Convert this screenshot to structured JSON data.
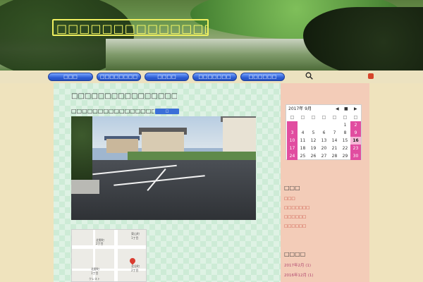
{
  "header": {
    "site_title": "□□□□□□□□□□□□□□□"
  },
  "nav": {
    "items": [
      {
        "label": "□□□"
      },
      {
        "label": "□□□□□□□□"
      },
      {
        "label": "□□□□"
      },
      {
        "label": "□□□□□□□"
      },
      {
        "label": "□□□□□□"
      }
    ]
  },
  "post": {
    "title": "□□□□□□□□□□□□□□□□□□□□□□□□□□□□",
    "subtitle": "□□□□□□□□□□□□□□□□□□□□□□□□□□□□",
    "badge": "□ □□□□□□□"
  },
  "calendar": {
    "month_label": "2017年 9月",
    "nav_prev": "◀",
    "nav_pause": "■",
    "nav_next": "▶",
    "dow": [
      "□",
      "□",
      "□",
      "□",
      "□",
      "□",
      "□"
    ],
    "weeks": [
      [
        "",
        "",
        "",
        "",
        "",
        "1",
        "2"
      ],
      [
        "3",
        "4",
        "5",
        "6",
        "7",
        "8",
        "9"
      ],
      [
        "10",
        "11",
        "12",
        "13",
        "14",
        "15",
        "16"
      ],
      [
        "17",
        "18",
        "19",
        "20",
        "21",
        "22",
        "23"
      ],
      [
        "24",
        "25",
        "26",
        "27",
        "28",
        "29",
        "30"
      ]
    ],
    "today": "16"
  },
  "sidebar": {
    "categories_heading": "□□□",
    "categories": [
      {
        "label": "□□□"
      },
      {
        "label": "□□□□□□□"
      },
      {
        "label": "□□□□□□"
      },
      {
        "label": "□□□□□□"
      }
    ],
    "archives_heading": "□□□□",
    "archives": [
      {
        "label": "2017年2月 (1)"
      },
      {
        "label": "2016年12月 (1)"
      }
    ]
  },
  "map": {
    "labels": [
      "東山町",
      "1丁目",
      "北野町",
      "2丁目",
      "北野町",
      "1丁目",
      "北谷町",
      "2丁目",
      "クレスト"
    ]
  },
  "colors": {
    "nav_button": "#2f5fd6",
    "title_text": "#ffff66",
    "calendar_weekend": "#e14da0",
    "link": "#c0392b"
  },
  "icons": {
    "search": "search-icon",
    "rss": "rss-icon"
  }
}
